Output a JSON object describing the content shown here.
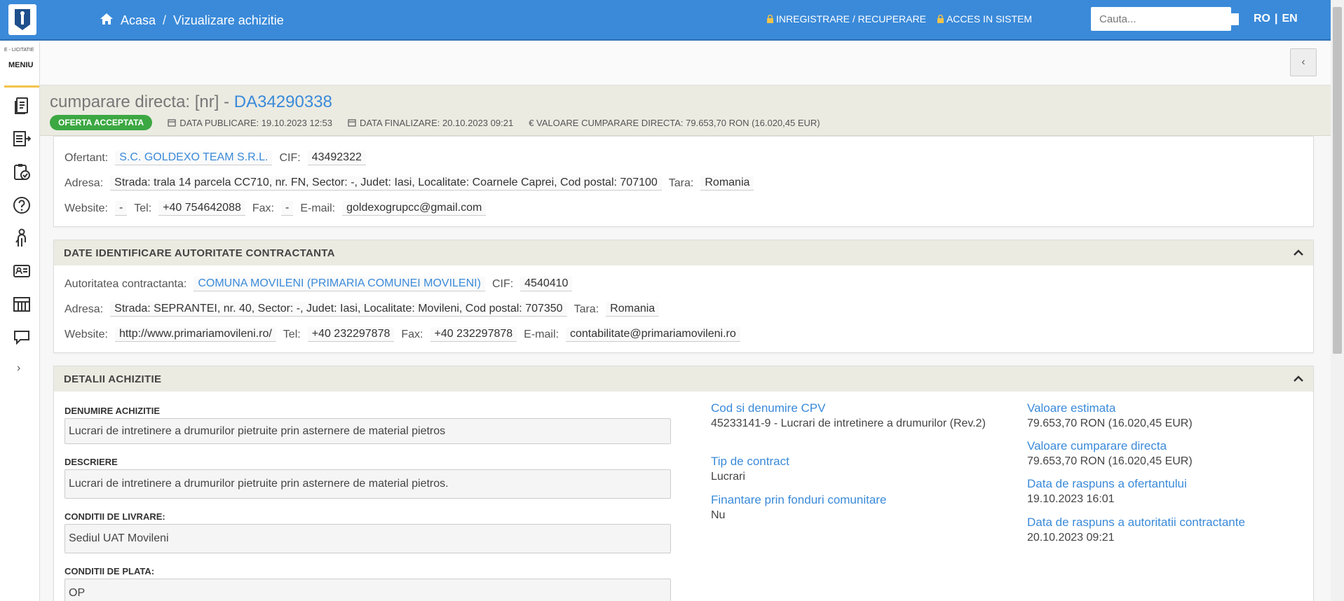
{
  "header": {
    "breadcrumb_home": "Acasa",
    "breadcrumb_sep": "/",
    "breadcrumb_current": "Vizualizare achizitie",
    "register_label": "INREGISTRARE / RECUPERARE",
    "login_label": "ACCES IN SISTEM",
    "search_placeholder": "Cauta...",
    "lang_ro": "RO",
    "lang_sep": "|",
    "lang_en": "EN"
  },
  "sidebar": {
    "brand": "E - LICITATIE",
    "menu_label": "MENIU",
    "icons": [
      "document-icon",
      "list-export-icon",
      "clipboard-check-icon",
      "help-icon",
      "person-icon",
      "id-card-icon",
      "building-icon",
      "chat-icon"
    ],
    "expand": "›"
  },
  "page": {
    "title_prefix": "cumparare directa: [nr] - ",
    "title_code": "DA34290338",
    "status_badge": "OFERTA ACCEPTATA",
    "published": "DATA PUBLICARE: 19.10.2023 12:53",
    "finalized": "DATA FINALIZARE: 20.10.2023 09:21",
    "value": "€ VALOARE CUMPARARE DIRECTA: 79.653,70  RON (16.020,45  EUR)"
  },
  "ofertant": {
    "label": "Ofertant:",
    "name": "S.C. GOLDEXO TEAM S.R.L.",
    "cif_label": "CIF:",
    "cif": "43492322",
    "address_label": "Adresa:",
    "address": "Strada: trala 14 parcela CC710, nr. FN, Sector: -, Judet: Iasi, Localitate: Coarnele Caprei, Cod postal: 707100",
    "country_label": "Tara:",
    "country": "Romania",
    "website_label": "Website:",
    "website": "-",
    "tel_label": "Tel:",
    "tel": "+40 754642088",
    "fax_label": "Fax:",
    "fax": "-",
    "email_label": "E-mail:",
    "email": "goldexogrupcc@gmail.com"
  },
  "authority": {
    "section_title": "DATE IDENTIFICARE AUTORITATE CONTRACTANTA",
    "label": "Autoritatea contractanta:",
    "name": "COMUNA MOVILENI (PRIMARIA COMUNEI MOVILENI)",
    "cif_label": "CIF:",
    "cif": "4540410",
    "address_label": "Adresa:",
    "address": "Strada: SEPRANTEI, nr. 40, Sector: -, Judet: Iasi, Localitate: Movileni, Cod postal: 707350",
    "country_label": "Tara:",
    "country": "Romania",
    "website_label": "Website:",
    "website": "http://www.primariamovileni.ro/",
    "tel_label": "Tel:",
    "tel": "+40 232297878",
    "fax_label": "Fax:",
    "fax": "+40 232297878",
    "email_label": "E-mail:",
    "email": "contabilitate@primariamovileni.ro"
  },
  "details": {
    "section_title": "DETALII ACHIZITIE",
    "name_label": "DENUMIRE ACHIZITIE",
    "name_value": "Lucrari de intretinere a drumurilor pietruite prin asternere de material pietros",
    "desc_label": "DESCRIERE",
    "desc_value": "Lucrari de intretinere a drumurilor pietruite prin asternere de material pietros.",
    "delivery_label": "CONDITII DE LIVRARE:",
    "delivery_value": "Sediul UAT Movileni",
    "payment_label": "CONDITII DE PLATA:",
    "payment_value": "OP",
    "cpv_title": "Cod si denumire CPV",
    "cpv_value": "45233141-9 - Lucrari de intretinere a drumurilor (Rev.2)",
    "contract_type_title": "Tip de contract",
    "contract_type_value": "Lucrari",
    "eu_funds_title": "Finantare prin fonduri comunitare",
    "eu_funds_value": "Nu",
    "estimated_title": "Valoare estimata",
    "estimated_value": "79.653,70  RON (16.020,45  EUR)",
    "direct_value_title": "Valoare cumparare directa",
    "direct_value_value": "79.653,70  RON (16.020,45  EUR)",
    "bidder_date_title": "Data de raspuns a ofertantului",
    "bidder_date_value": "19.10.2023 16:01",
    "authority_date_title": "Data de raspuns a autoritatii contractante",
    "authority_date_value": "20.10.2023 09:21"
  },
  "colors": {
    "primary": "#3a8ad9",
    "badge_green": "#3ca842",
    "band": "#ebebe2"
  }
}
